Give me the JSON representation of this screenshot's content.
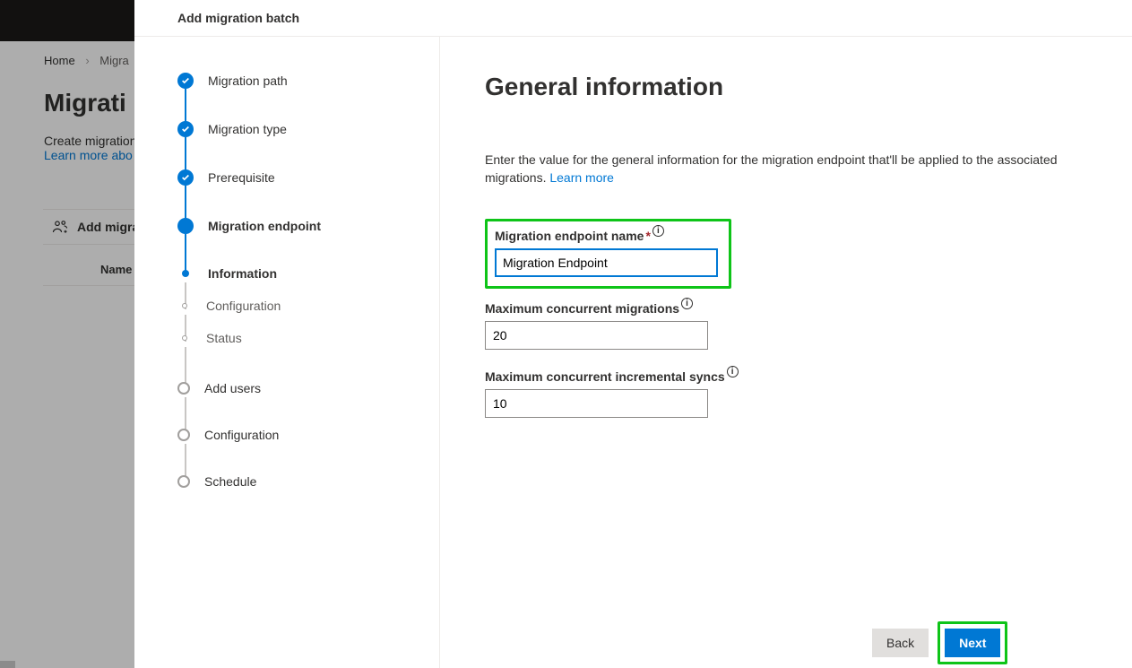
{
  "backdrop": {
    "breadcrumb_home": "Home",
    "breadcrumb_current": "Migra",
    "page_title": "Migrati",
    "subtitle": "Create migration",
    "learn_more": "Learn more abo",
    "toolbar_add": "Add migrat",
    "column_name": "Name"
  },
  "panel": {
    "title": "Add migration batch"
  },
  "stepper": {
    "items": [
      {
        "label": "Migration path"
      },
      {
        "label": "Migration type"
      },
      {
        "label": "Prerequisite"
      },
      {
        "label": "Migration endpoint"
      },
      {
        "label": "Information"
      },
      {
        "label": "Configuration"
      },
      {
        "label": "Status"
      },
      {
        "label": "Add users"
      },
      {
        "label": "Configuration"
      },
      {
        "label": "Schedule"
      }
    ]
  },
  "content": {
    "heading": "General information",
    "description": "Enter the value for the general information for the migration endpoint that'll be applied to the associated migrations.",
    "learn_more": "Learn more",
    "fields": {
      "endpoint_name_label": "Migration endpoint name",
      "endpoint_name_value": "Migration Endpoint",
      "max_migrations_label": "Maximum concurrent migrations",
      "max_migrations_value": "20",
      "max_syncs_label": "Maximum concurrent incremental syncs",
      "max_syncs_value": "10"
    }
  },
  "footer": {
    "back": "Back",
    "next": "Next"
  }
}
